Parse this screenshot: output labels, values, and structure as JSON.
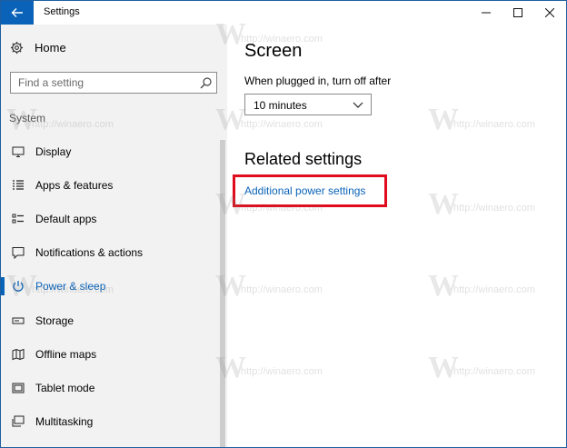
{
  "window": {
    "title": "Settings"
  },
  "sidebar": {
    "home_label": "Home",
    "search_placeholder": "Find a setting",
    "section": "System",
    "items": [
      {
        "label": "Display",
        "icon": "monitor-icon"
      },
      {
        "label": "Apps & features",
        "icon": "list-icon"
      },
      {
        "label": "Default apps",
        "icon": "default-apps-icon"
      },
      {
        "label": "Notifications & actions",
        "icon": "notification-icon"
      },
      {
        "label": "Power & sleep",
        "icon": "power-icon",
        "active": true
      },
      {
        "label": "Storage",
        "icon": "storage-icon"
      },
      {
        "label": "Offline maps",
        "icon": "map-icon"
      },
      {
        "label": "Tablet mode",
        "icon": "tablet-icon"
      },
      {
        "label": "Multitasking",
        "icon": "multitasking-icon"
      }
    ]
  },
  "content": {
    "screen_title": "Screen",
    "plugged_in_label": "When plugged in, turn off after",
    "timeout_value": "10 minutes",
    "related_title": "Related settings",
    "power_link": "Additional power settings"
  },
  "watermark": {
    "letter": "W",
    "text": "http://winaero.com"
  },
  "colors": {
    "accent": "#0a63b8",
    "highlight": "#e00b1c"
  }
}
